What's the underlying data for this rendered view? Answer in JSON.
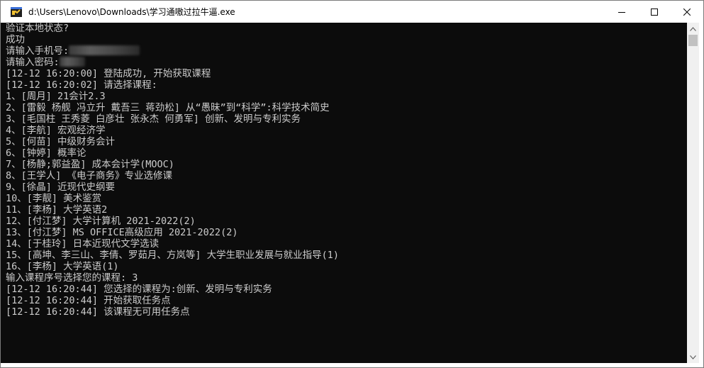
{
  "window": {
    "title": "d:\\Users\\Lenovo\\Downloads\\学习通嗷过拉牛逼.exe",
    "controls": {
      "minimize": "minimize-icon",
      "maximize": "maximize-icon",
      "close": "close-icon"
    }
  },
  "console": {
    "colors": {
      "background": "#0c0c0c",
      "text": "#cccccc"
    },
    "lines": [
      "验证本地状态?",
      "成功",
      "请输入手机号:",
      "请输入密码:",
      "[12-12 16:20:00] 登陆成功, 开始获取课程",
      "[12-12 16:20:02] 请选择课程:",
      "1、[周月] 21会计2.3",
      "2、[雷毅 杨舰 冯立升 戴吾三 蒋劲松] 从“愚昧”到“科学”:科学技术简史",
      "3、[毛国柱 王秀菱 白彦壮 张永杰 何勇军] 创新、发明与专利实务",
      "4、[李航] 宏观经济学",
      "5、[何苗] 中级财务会计",
      "6、[钟婷] 概率论",
      "7、[杨静;郭益盈] 成本会计学(MOOC)",
      "8、[王学人] 《电子商务》专业选修课",
      "9、[徐晶] 近现代史纲要",
      "10、[李靓] 美术鉴赏",
      "11、[李杨] 大学英语2",
      "12、[付江梦] 大学计算机 2021-2022(2)",
      "13、[付江梦] MS OFFICE高级应用 2021-2022(2)",
      "14、[于桂玲] 日本近现代文学选读",
      "15、[高坤、李三山、李倩、罗茹月、方岚等] 大学生职业发展与就业指导(1)",
      "16、[李杨] 大学英语(1)",
      "输入课程序号选择您的课程: 3",
      "[12-12 16:20:44] 您选择的课程为:创新、发明与专利实务",
      "[12-12 16:20:44] 开始获取任务点",
      "[12-12 16:20:44] 该课程无可用任务点"
    ]
  }
}
